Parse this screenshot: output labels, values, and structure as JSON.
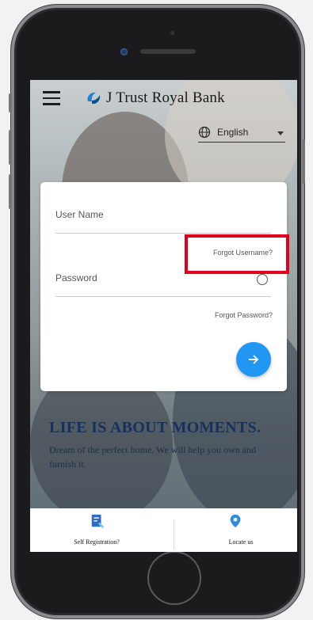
{
  "header": {
    "brand_name": "J Trust Royal Bank",
    "menu_icon": "hamburger-menu-icon"
  },
  "language": {
    "selected": "English",
    "icon": "globe-icon"
  },
  "login": {
    "username_placeholder": "User Name",
    "forgot_username": "Forgot Username?",
    "password_placeholder": "Password",
    "forgot_password": "Forgot Password?",
    "submit_icon": "arrow-right-icon"
  },
  "banner": {
    "headline": "LIFE IS ABOUT MOMENTS.",
    "subtext": "Dream of the perfect home. We will help you own and furnish it."
  },
  "bottom_nav": {
    "self_registration": "Self Registration?",
    "locate_us": "Locate us"
  },
  "colors": {
    "accent": "#2196f3",
    "highlight": "#e0001b",
    "headline": "#16305e"
  }
}
